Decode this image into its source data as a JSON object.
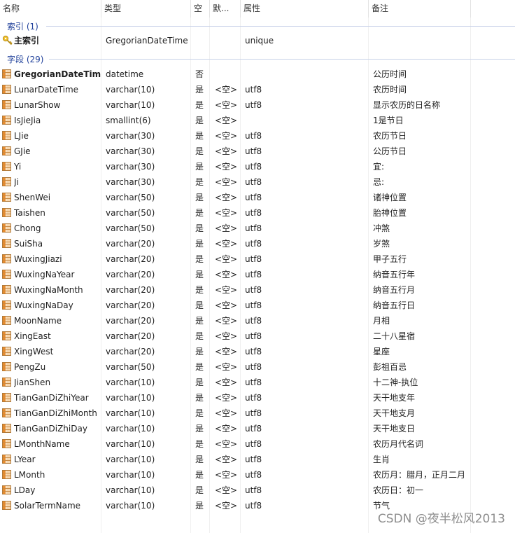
{
  "columns": {
    "name": "名称",
    "type": "类型",
    "null": "空",
    "default": "默...",
    "attr": "属性",
    "note": "备注"
  },
  "index_group": {
    "label": "索引 (1)"
  },
  "index": {
    "name": "主索引",
    "type": "GregorianDateTime",
    "attr": "unique"
  },
  "field_group": {
    "label": "字段 (29)"
  },
  "fields": [
    {
      "name": "GregorianDateTime",
      "type": "datetime",
      "null": "否",
      "default": "",
      "attr": "",
      "note": "公历时间"
    },
    {
      "name": "LunarDateTime",
      "type": "varchar(10)",
      "null": "是",
      "default": "<空>",
      "attr": "utf8",
      "note": "农历时间"
    },
    {
      "name": "LunarShow",
      "type": "varchar(10)",
      "null": "是",
      "default": "<空>",
      "attr": "utf8",
      "note": "显示农历的日名称"
    },
    {
      "name": "IsJieJia",
      "type": "smallint(6)",
      "null": "是",
      "default": "<空>",
      "attr": "",
      "note": "1是节日"
    },
    {
      "name": "LJie",
      "type": "varchar(30)",
      "null": "是",
      "default": "<空>",
      "attr": "utf8",
      "note": "农历节日"
    },
    {
      "name": "GJie",
      "type": "varchar(30)",
      "null": "是",
      "default": "<空>",
      "attr": "utf8",
      "note": "公历节日"
    },
    {
      "name": "Yi",
      "type": "varchar(30)",
      "null": "是",
      "default": "<空>",
      "attr": "utf8",
      "note": "宜:"
    },
    {
      "name": "Ji",
      "type": "varchar(30)",
      "null": "是",
      "default": "<空>",
      "attr": "utf8",
      "note": "忌:"
    },
    {
      "name": "ShenWei",
      "type": "varchar(50)",
      "null": "是",
      "default": "<空>",
      "attr": "utf8",
      "note": "诸神位置"
    },
    {
      "name": "Taishen",
      "type": "varchar(50)",
      "null": "是",
      "default": "<空>",
      "attr": "utf8",
      "note": "胎神位置"
    },
    {
      "name": "Chong",
      "type": "varchar(50)",
      "null": "是",
      "default": "<空>",
      "attr": "utf8",
      "note": "冲煞"
    },
    {
      "name": "SuiSha",
      "type": "varchar(20)",
      "null": "是",
      "default": "<空>",
      "attr": "utf8",
      "note": "岁煞"
    },
    {
      "name": "WuxingJiazi",
      "type": "varchar(20)",
      "null": "是",
      "default": "<空>",
      "attr": "utf8",
      "note": "甲子五行"
    },
    {
      "name": "WuxingNaYear",
      "type": "varchar(20)",
      "null": "是",
      "default": "<空>",
      "attr": "utf8",
      "note": "纳音五行年"
    },
    {
      "name": "WuxingNaMonth",
      "type": "varchar(20)",
      "null": "是",
      "default": "<空>",
      "attr": "utf8",
      "note": "纳音五行月"
    },
    {
      "name": "WuxingNaDay",
      "type": "varchar(20)",
      "null": "是",
      "default": "<空>",
      "attr": "utf8",
      "note": "纳音五行日"
    },
    {
      "name": "MoonName",
      "type": "varchar(20)",
      "null": "是",
      "default": "<空>",
      "attr": "utf8",
      "note": "月相"
    },
    {
      "name": "XingEast",
      "type": "varchar(20)",
      "null": "是",
      "default": "<空>",
      "attr": "utf8",
      "note": "二十八星宿"
    },
    {
      "name": "XingWest",
      "type": "varchar(20)",
      "null": "是",
      "default": "<空>",
      "attr": "utf8",
      "note": "星座"
    },
    {
      "name": "PengZu",
      "type": "varchar(50)",
      "null": "是",
      "default": "<空>",
      "attr": "utf8",
      "note": "彭祖百忌"
    },
    {
      "name": "JianShen",
      "type": "varchar(10)",
      "null": "是",
      "default": "<空>",
      "attr": "utf8",
      "note": "十二神-执位"
    },
    {
      "name": "TianGanDiZhiYear",
      "type": "varchar(10)",
      "null": "是",
      "default": "<空>",
      "attr": "utf8",
      "note": "天干地支年"
    },
    {
      "name": "TianGanDiZhiMonth",
      "type": "varchar(10)",
      "null": "是",
      "default": "<空>",
      "attr": "utf8",
      "note": "天干地支月"
    },
    {
      "name": "TianGanDiZhiDay",
      "type": "varchar(10)",
      "null": "是",
      "default": "<空>",
      "attr": "utf8",
      "note": "天干地支日"
    },
    {
      "name": "LMonthName",
      "type": "varchar(10)",
      "null": "是",
      "default": "<空>",
      "attr": "utf8",
      "note": "农历月代名词"
    },
    {
      "name": "LYear",
      "type": "varchar(10)",
      "null": "是",
      "default": "<空>",
      "attr": "utf8",
      "note": "生肖"
    },
    {
      "name": "LMonth",
      "type": "varchar(10)",
      "null": "是",
      "default": "<空>",
      "attr": "utf8",
      "note": "农历月：腊月，正月二月"
    },
    {
      "name": "LDay",
      "type": "varchar(10)",
      "null": "是",
      "default": "<空>",
      "attr": "utf8",
      "note": "农历日：初一"
    },
    {
      "name": "SolarTermName",
      "type": "varchar(10)",
      "null": "是",
      "default": "<空>",
      "attr": "utf8",
      "note": "节气"
    }
  ],
  "watermark": "CSDN @夜半松风2013"
}
